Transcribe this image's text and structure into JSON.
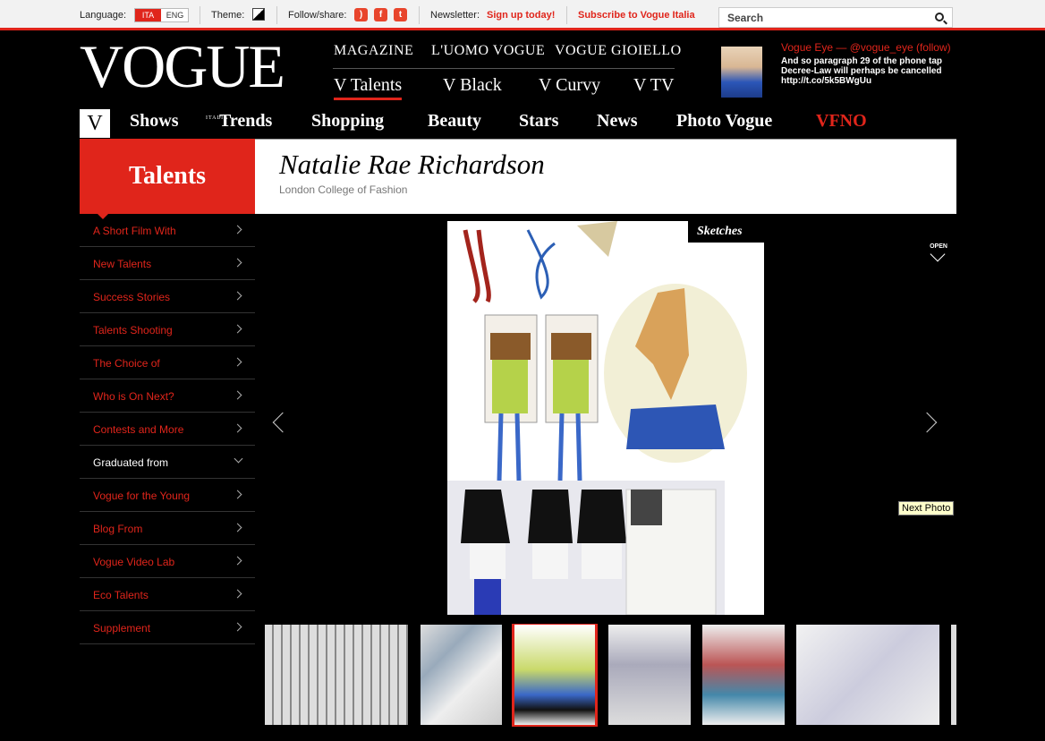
{
  "topbar": {
    "language_label": "Language:",
    "lang_ita": "ITA",
    "lang_eng": "ENG",
    "theme_label": "Theme:",
    "follow_label": "Follow/share:",
    "social": [
      "rss-icon",
      "facebook-icon",
      "twitter-icon"
    ],
    "newsletter_label": "Newsletter:",
    "signup": "Sign up today!",
    "subscribe": "Subscribe to Vogue Italia",
    "search_label": "Search"
  },
  "logo": {
    "text": "VOGUE",
    "sub": "ITALIA"
  },
  "topnav": [
    "MAGAZINE",
    "L'UOMO VOGUE",
    "VOGUE GIOIELLO"
  ],
  "subnav": [
    "V Talents",
    "V Black",
    "V Curvy",
    "V TV"
  ],
  "vogue_eye": {
    "title": "Vogue Eye — @vogue_eye (follow)",
    "text": "And so paragraph 29 of the phone tap Decree-Law will perhaps be cancelled http://t.co/5k5BWgUu"
  },
  "mainnav": {
    "v": "V",
    "items": [
      "Shows",
      "Trends",
      "Shopping",
      "Beauty",
      "Stars",
      "News",
      "Photo Vogue",
      "VFNO"
    ]
  },
  "section": {
    "title": "Talents"
  },
  "profile": {
    "name": "Natalie Rae Richardson",
    "school": "London College of Fashion"
  },
  "sidebar": [
    "A Short Film With",
    "New Talents",
    "Success Stories",
    "Talents Shooting",
    "The Choice of",
    "Who is On Next?",
    "Contests and More",
    "Graduated from",
    "Vogue for the Young",
    "Blog From",
    "Vogue Video Lab",
    "Eco Talents",
    "Supplement"
  ],
  "gallery": {
    "label": "Sketches",
    "open": "OPEN",
    "next_tooltip": "Next Photo"
  },
  "colors": {
    "accent": "#e0251b",
    "background": "#000000"
  }
}
